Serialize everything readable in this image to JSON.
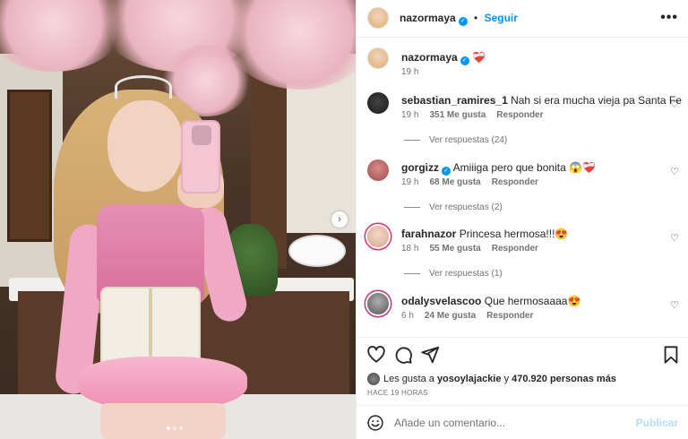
{
  "post": {
    "author": "nazormaya",
    "follow_label": "Seguir",
    "caption_emoji": "❤️‍🩹",
    "caption_time": "19 h",
    "more_icon": "more-horizontal-icon"
  },
  "comments": [
    {
      "username": "sebastian_ramires_1",
      "text": "Nah si era mucha vieja pa Santa Fe",
      "time": "19 h",
      "likes": "351 Me gusta",
      "reply_label": "Responder",
      "view_replies": "Ver respuestas (24)"
    },
    {
      "username": "gorgizz",
      "text": "Amiiiga pero que bonita 😱❤️‍🩹",
      "time": "19 h",
      "likes": "68 Me gusta",
      "reply_label": "Responder",
      "view_replies": "Ver respuestas (2)"
    },
    {
      "username": "farahnazor",
      "text": "Princesa hermosa!!!😍",
      "time": "18 h",
      "likes": "55 Me gusta",
      "reply_label": "Responder",
      "view_replies": "Ver respuestas (1)"
    },
    {
      "username": "odalysvelascoo",
      "text": "Que hermosaaaa😍",
      "time": "6 h",
      "likes": "24 Me gusta",
      "reply_label": "Responder"
    }
  ],
  "likes_summary": {
    "prefix": "Les gusta a",
    "user": "yosoylajackie",
    "connector": "y",
    "count": "470.920 personas más"
  },
  "post_time": "HACE 19 HORAS",
  "add_comment": {
    "placeholder": "Añade un comentario...",
    "post_label": "Publicar"
  },
  "colors": {
    "accent": "#0095f6",
    "muted": "#737373",
    "post_disabled": "#b2dffc"
  }
}
